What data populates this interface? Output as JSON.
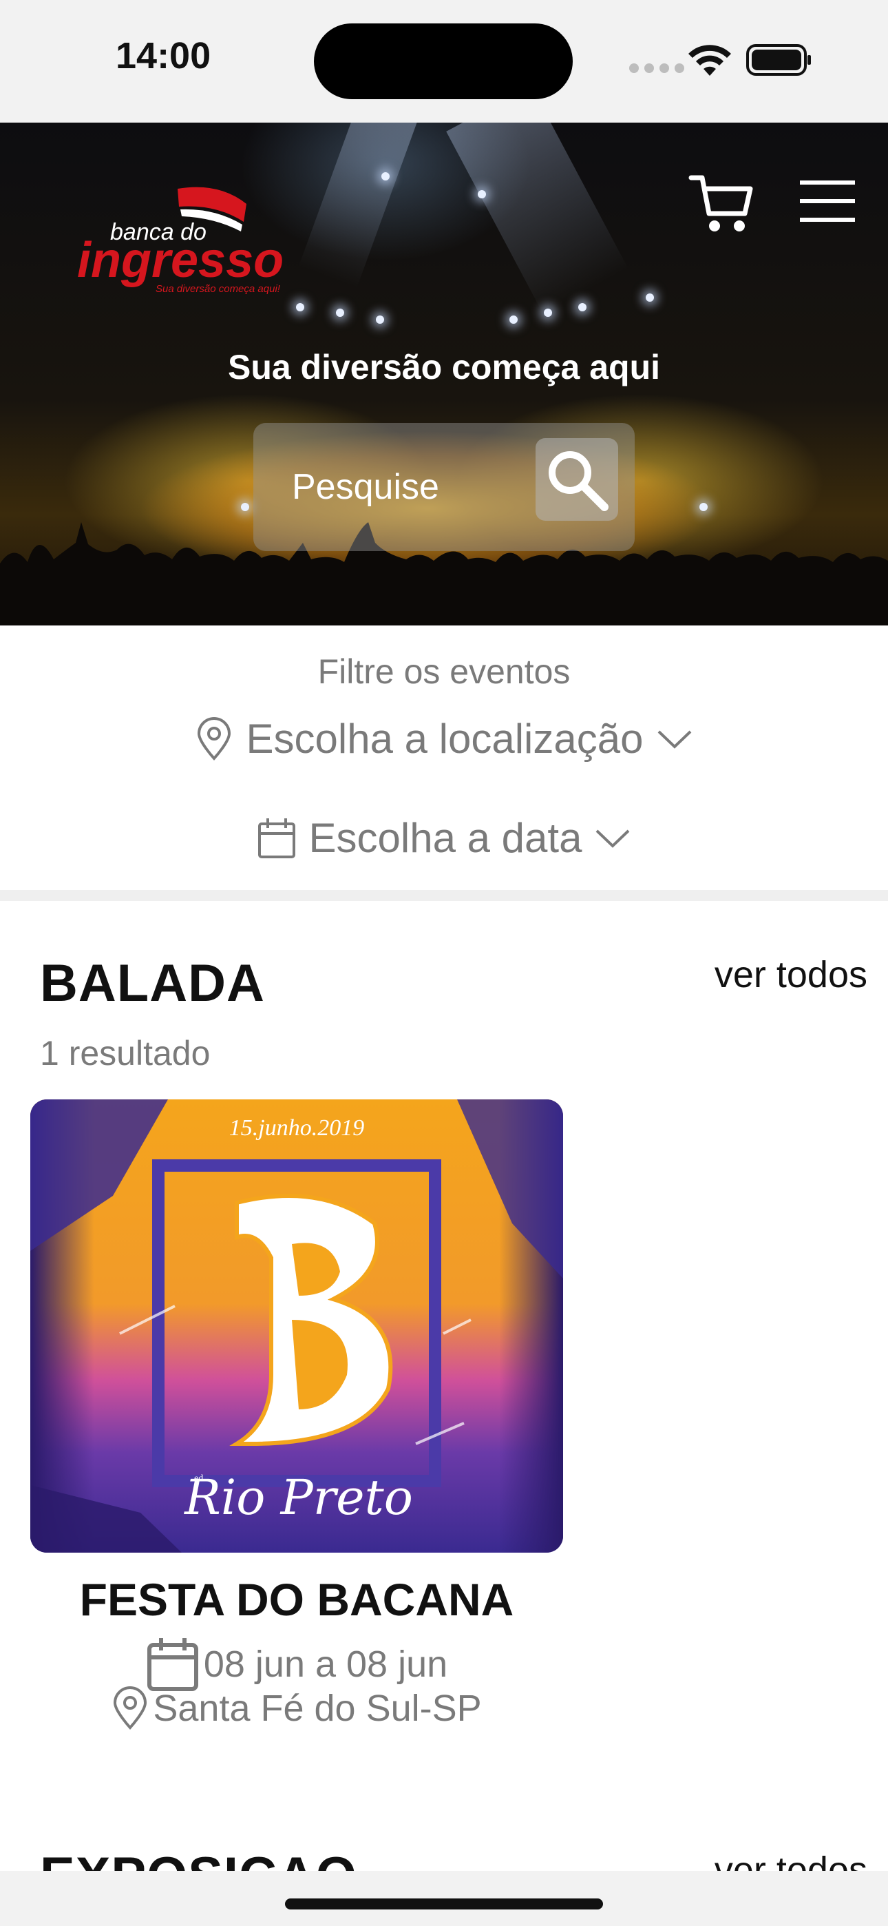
{
  "status_bar": {
    "time": "14:00"
  },
  "header": {
    "logo": {
      "line1": "banca do",
      "line2": "ingresso",
      "tagline": "Sua diversão começa aqui!"
    },
    "icons": {
      "cart": "cart-icon",
      "menu": "menu-icon"
    },
    "title": "Sua diversão começa aqui",
    "search": {
      "placeholder": "Pesquise",
      "value": ""
    }
  },
  "filters": {
    "label": "Filtre os eventos",
    "location_label": "Escolha a localização",
    "date_label": "Escolha a data"
  },
  "sections": [
    {
      "title": "BALADA",
      "see_all_label": "ver todos",
      "results_label": "1 resultado",
      "events": [
        {
          "name": "FESTA DO BACANA",
          "dates": "08 jun a 08 jun",
          "location": "Santa Fé do Sul-SP",
          "poster": {
            "date_text": "15.junho.2019",
            "letter": "B",
            "ed_text": "ed.",
            "script_text": "Rio Preto"
          }
        }
      ]
    },
    {
      "title": "EXPOSICAO",
      "see_all_label": "ver todos"
    }
  ],
  "colors": {
    "brand_red": "#d6161e",
    "muted_text": "#7a7a7a",
    "poster_orange": "#f4a51c",
    "poster_purple": "#4b3aa8"
  }
}
